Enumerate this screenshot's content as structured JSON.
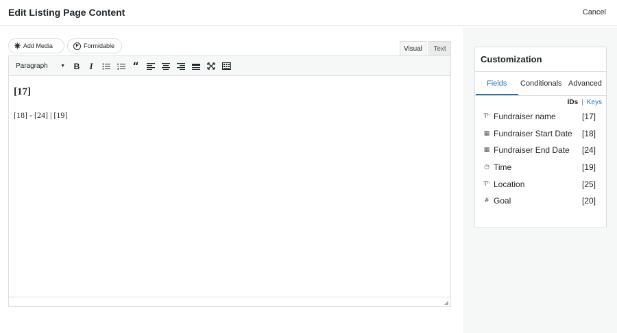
{
  "header": {
    "title": "Edit Listing Page Content",
    "cancel_label": "Cancel"
  },
  "media_buttons": {
    "add_media": {
      "icon": "add-media-icon",
      "label": "Add Media"
    },
    "formidable": {
      "icon": "formidable-icon",
      "label": "Formidable"
    }
  },
  "editor_tabs": {
    "visual": "Visual",
    "text": "Text"
  },
  "toolbar": {
    "format_value": "Paragraph",
    "buttons": [
      "bold",
      "italic",
      "bulleted-list",
      "numbered-list",
      "blockquote",
      "align-left",
      "align-center",
      "align-right",
      "horizontal-line",
      "fullscreen",
      "toolbar-toggle"
    ]
  },
  "content": {
    "heading": "[17]",
    "paragraph": "[18] - [24] | [19]"
  },
  "customization": {
    "title": "Customization",
    "tabs": [
      "Fields",
      "Conditionals",
      "Advanced"
    ],
    "active_tab": "Fields",
    "toggle": {
      "ids": "IDs",
      "separator": "|",
      "keys": "Keys"
    },
    "fields": [
      {
        "icon": "text-icon",
        "name": "Fundraiser name",
        "id": "[17]"
      },
      {
        "icon": "calendar-icon",
        "name": "Fundraiser Start Date",
        "id": "[18]"
      },
      {
        "icon": "calendar-icon",
        "name": "Fundraiser End Date",
        "id": "[24]"
      },
      {
        "icon": "clock-icon",
        "name": "Time",
        "id": "[19]"
      },
      {
        "icon": "text-icon",
        "name": "Location",
        "id": "[25]"
      },
      {
        "icon": "hash-icon",
        "name": "Goal",
        "id": "[20]"
      }
    ]
  },
  "colors": {
    "accent": "#2271b1",
    "border": "#dcdcde",
    "panel_bg": "#f6f7f7"
  }
}
